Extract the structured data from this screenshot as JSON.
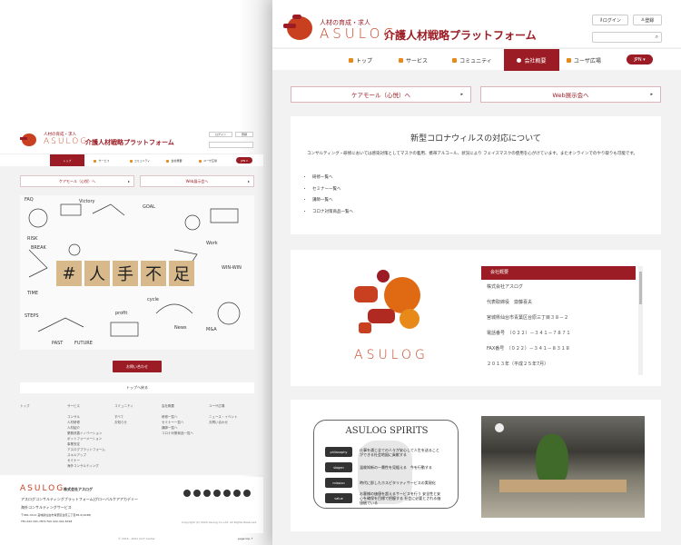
{
  "header": {
    "tagline": "人材の育成・求人",
    "logo": "ASULOG",
    "title": "介護人材戦略プラットフォーム",
    "login": "ログイン",
    "register": "登録",
    "search_placeholder": ""
  },
  "nav": {
    "items": [
      {
        "label": "トップ"
      },
      {
        "label": "サービス"
      },
      {
        "label": "コミュニティ"
      },
      {
        "label": "会社概要"
      },
      {
        "label": "ユーザ広場"
      }
    ],
    "lang": "JPN ▾"
  },
  "links": {
    "caremall": "ケアモール（心悦）へ",
    "web_expo": "Web展示会へ",
    "arrow": "▸"
  },
  "hero": {
    "blocks": [
      "#",
      "人",
      "手",
      "不",
      "足"
    ],
    "doodles": [
      "FAQ",
      "Victory",
      "RISK",
      "TIME",
      "BREAK",
      "GOAL",
      "WIN-WIN",
      "News",
      "PAST",
      "FUTURE",
      "STEPS",
      "M&A",
      "cycle",
      "profit",
      "Work"
    ]
  },
  "contact_button": "お問い合わせ",
  "back_to_top": "トップへ戻る",
  "footer": {
    "columns": [
      {
        "title": "トップ",
        "items": []
      },
      {
        "title": "サービス",
        "items": [
          "コンサル",
          "人材研修",
          "人材紹介",
          "業務改善イノベーション",
          "ボットフォーメーション",
          "事業安定",
          "アスログプラットフォーム",
          "スキルアップ",
          "セミナー",
          "海外コンサルティング"
        ]
      },
      {
        "title": "コミュニティ",
        "items": [
          "すべて",
          "お知らせ"
        ]
      },
      {
        "title": "会社概要",
        "items": [
          "研修一覧へ",
          "セミナー一覧へ",
          "講師一覧へ",
          "コロナ対策商品一覧へ"
        ]
      },
      {
        "title": "ユーザ広場",
        "items": [
          "ニュース・イベント",
          "お問い合わせ"
        ]
      }
    ],
    "company_logo": "ASULOG",
    "company_name": "株式会社アスログ",
    "desc1": "アスログコンサルティングプラットフォーム|グローバルケアアカデミー",
    "desc2": "海外コンサルティングサービス",
    "address": "〒981-3111 宮城県仙台市青葉区台原三丁目38-2(1048)",
    "tel": "TEL 022-341-7871 FAX 022-341-8318",
    "copyright": "Copyright (C) 2020 Asulog Co.,Ltd. All Rights Reserved.",
    "bottom": "© 2016 - 2021 AloT Center",
    "bottom_right": "page top ↑",
    "social": [
      "twitter-icon",
      "facebook-icon",
      "instagram-icon",
      "line-icon",
      "chat-icon",
      "youtube-icon",
      "blog-icon"
    ]
  },
  "corona": {
    "title": "新型コロナウィルスの対応について",
    "body": "コンサルティング・研修においては感染対策としてマスクの着用、携帯アルコール、状況により フェイスマスクの使用を心がけています。またオンラインでのやり取りも可能です。",
    "items": [
      "研修一覧へ",
      "セミナー一覧へ",
      "講師一覧へ",
      "コロナ対策商品一覧へ"
    ]
  },
  "company": {
    "header": "会社概要",
    "logo": "ASULOG",
    "rows": [
      "株式会社アスログ",
      "代表取締役　齋藤喜夫",
      "宮城県仙台市青葉区台原三丁目３８－２",
      "電話番号　（０２２）－３４１－７８７１",
      "FAX番号　（０２２）－３４１－８３１８",
      "２０１３年（平成２５年7月）"
    ],
    "scroll_fraction": 0.3
  },
  "spirits": {
    "title": "ASULOG SPIRITS",
    "items": [
      {
        "label": "philosophy",
        "text": "仕事を通じ全ての人々が安心して人生を送ることができる社会地図に貢献する"
      },
      {
        "label": "slogan",
        "text": "温故知新の一貫性を見据える　今を行動する"
      },
      {
        "label": "mission",
        "text": "時代に即したホスピタリティサービスの実現化"
      },
      {
        "label": "value",
        "text": "お客様の価値を超えるサービスを行う 安全性と安心を確保を目標で把握する 社会に必要とされる価値観でいる"
      }
    ]
  },
  "colors": {
    "brand": "#9b1c24",
    "accent": "#e88a1a",
    "logo": "#c8401f"
  }
}
